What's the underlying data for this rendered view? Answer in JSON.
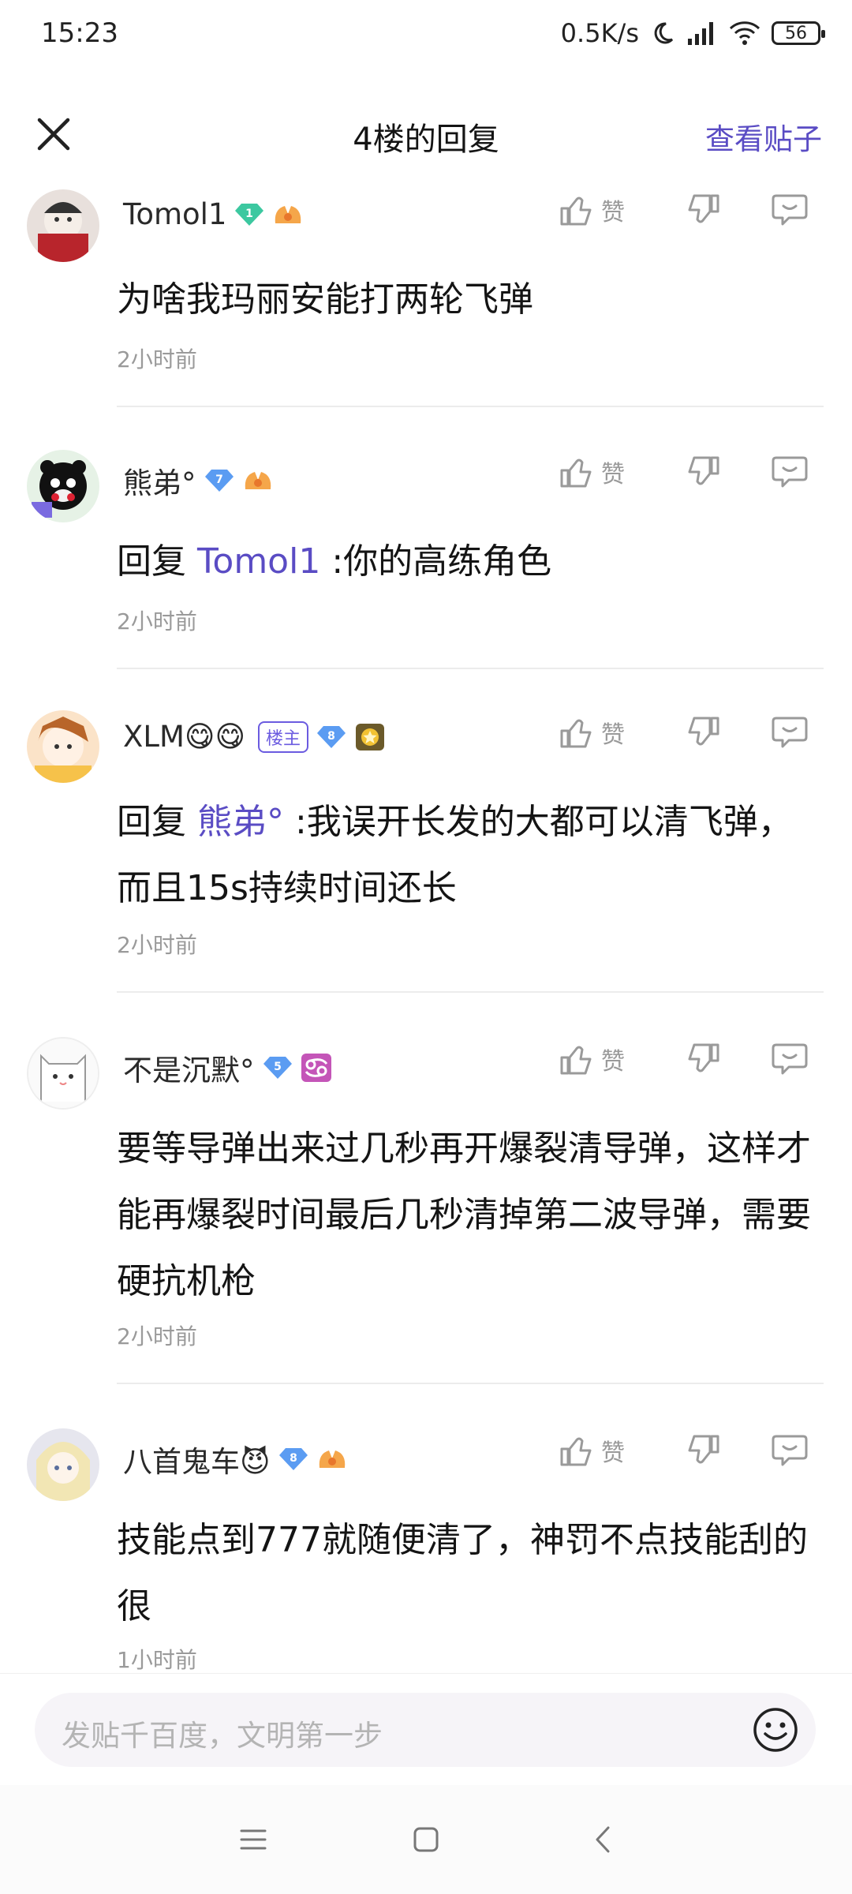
{
  "status_bar": {
    "time": "15:23",
    "net_speed": "0.5K/s",
    "battery": "56"
  },
  "header": {
    "title": "4楼的回复",
    "view_post": "查看贴子"
  },
  "actions": {
    "like_label": "赞"
  },
  "comments": [
    {
      "username": "Tomol1",
      "level": "1",
      "text_plain": "为啥我玛丽安能打两轮飞弹",
      "time": "2小时前"
    },
    {
      "username": "熊弟°",
      "level": "7",
      "reply_prefix": "回复",
      "mention": "Tomol1",
      "text_after": " :你的高练角色",
      "time": "2小时前"
    },
    {
      "username": "XLM😋😋",
      "owner_tag": "楼主",
      "level": "8",
      "reply_prefix": "回复",
      "mention": "熊弟°",
      "text_after": " :我误开长发的大都可以清飞弹，而且15s持续时间还长",
      "time": "2小时前"
    },
    {
      "username": "不是沉默°",
      "level": "5",
      "text_plain": "要等导弹出来过几秒再开爆裂清导弹，这样才能再爆裂时间最后几秒清掉第二波导弹，需要硬抗机枪",
      "time": "2小时前"
    },
    {
      "username": "八首鬼车😈",
      "level": "8",
      "text_plain": "技能点到777就随便清了，神罚不点技能刮的很",
      "time": "1小时前"
    }
  ],
  "input": {
    "placeholder": "发贴千百度，文明第一步"
  },
  "colors": {
    "accent": "#5a4cc4",
    "diamond_teal": "#3cc8a0",
    "diamond_blue": "#5b9cf2"
  }
}
